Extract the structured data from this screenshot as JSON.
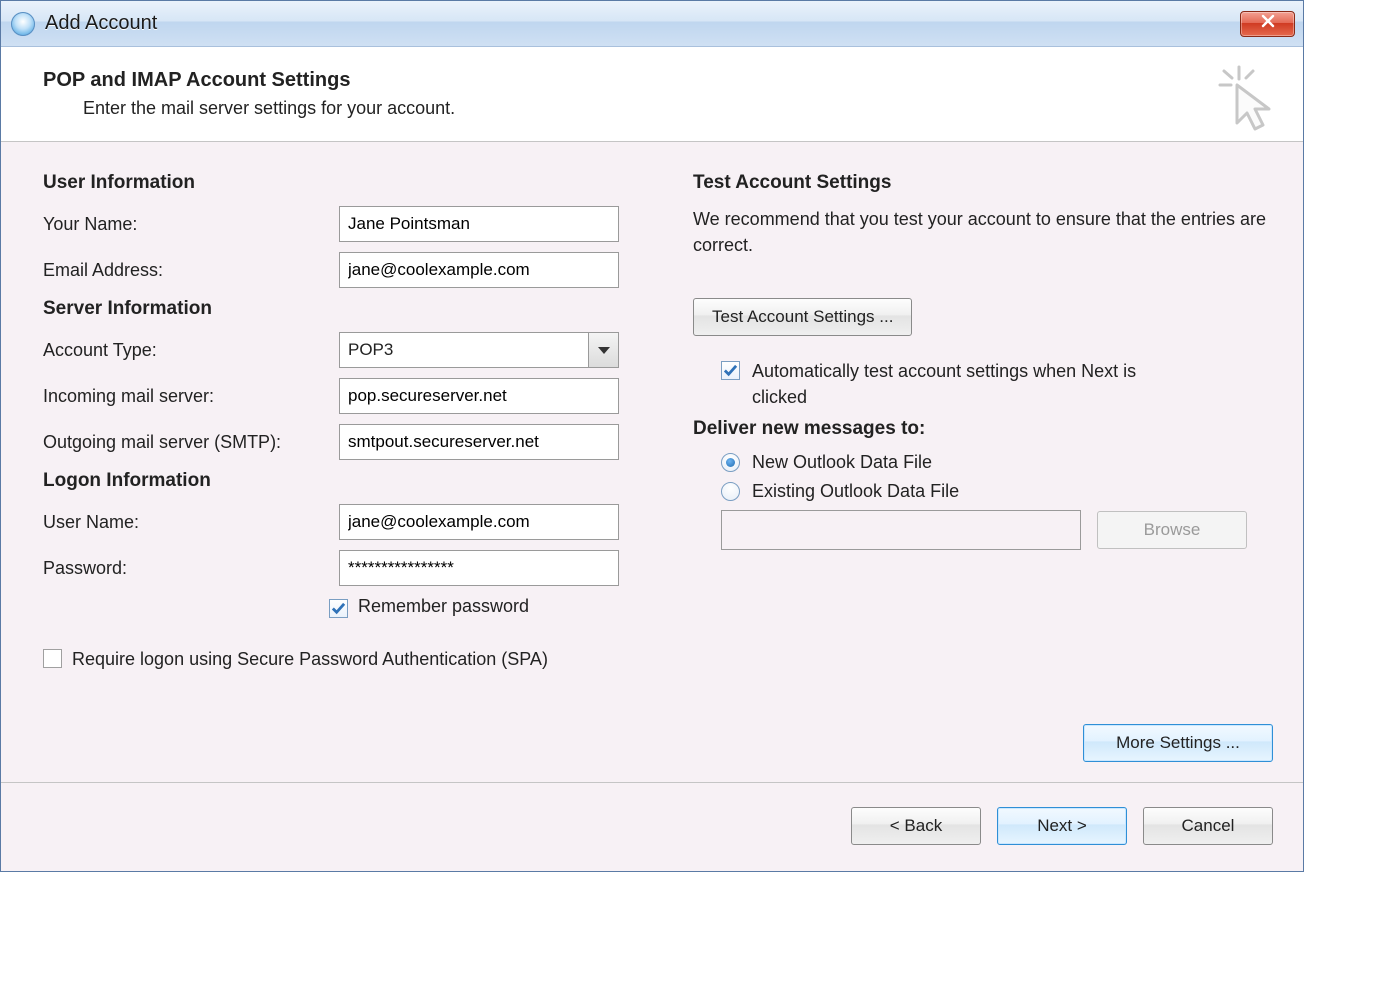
{
  "window": {
    "title": "Add Account"
  },
  "header": {
    "title": "POP and IMAP Account Settings",
    "subtitle": "Enter the mail server settings for your account."
  },
  "sections": {
    "user_info": "User Information",
    "server_info": "Server Information",
    "logon_info": "Logon Information",
    "test": "Test Account Settings",
    "deliver": "Deliver new messages to:"
  },
  "labels": {
    "your_name": "Your Name:",
    "email": "Email Address:",
    "account_type": "Account Type:",
    "incoming": "Incoming mail server:",
    "outgoing": "Outgoing mail server (SMTP):",
    "user_name": "User Name:",
    "password": "Password:",
    "remember": "Remember password",
    "spa": "Require logon using Secure Password Authentication (SPA)",
    "test_desc": "We recommend that you test your account to ensure that the entries are correct.",
    "auto_test": "Automatically test account settings when Next is clicked",
    "radio_new": "New Outlook Data File",
    "radio_existing": "Existing Outlook Data File"
  },
  "values": {
    "your_name": "Jane Pointsman",
    "email": "jane@coolexample.com",
    "account_type": "POP3",
    "incoming": "pop.secureserver.net",
    "outgoing": "smtpout.secureserver.net",
    "user_name": "jane@coolexample.com",
    "password": "****************",
    "existing_path": ""
  },
  "buttons": {
    "test": "Test Account Settings ...",
    "browse": "Browse",
    "more": "More Settings ...",
    "back": "<  Back",
    "next": "Next  >",
    "cancel": "Cancel"
  },
  "state": {
    "remember_checked": true,
    "spa_checked": false,
    "auto_test_checked": true,
    "deliver_selected": "new"
  }
}
